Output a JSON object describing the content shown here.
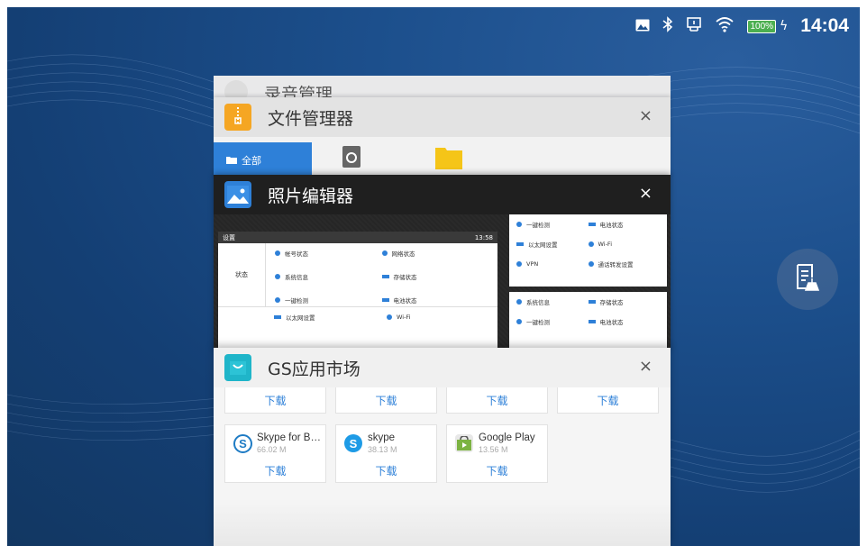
{
  "status_bar": {
    "battery": "100%",
    "time": "14:04"
  },
  "cards": {
    "recorder": {
      "title": "录音管理",
      "close": "×"
    },
    "file_manager": {
      "title": "文件管理器",
      "close": "×",
      "tab_all": "全部"
    },
    "photo_editor": {
      "title": "照片编辑器",
      "close": "×",
      "preview": {
        "settings_title": "设置",
        "status_time": "13:58",
        "section": "状态",
        "items": [
          "帐号状态",
          "网络状态",
          "系统信息",
          "存储状态",
          "一键检测",
          "电池状态",
          "以太网设置",
          "Wi-Fi"
        ],
        "right_items": [
          "一键检测",
          "电池状态",
          "以太网设置",
          "Wi-Fi",
          "VPN",
          "通话转发设置",
          "系统信息",
          "存储状态",
          "一键检测",
          "电池状态"
        ]
      }
    },
    "app_store": {
      "title": "GS应用市场",
      "close": "×",
      "download_label": "下载",
      "apps": [
        {
          "name": "Skype for Bus...",
          "size": "66.02 M",
          "icon": "skype-business-icon"
        },
        {
          "name": "skype",
          "size": "38.13 M",
          "icon": "skype-icon"
        },
        {
          "name": "Google Play",
          "size": "13.56 M",
          "icon": "google-play-icon"
        }
      ]
    }
  },
  "colors": {
    "accent": "#2e80d8",
    "wallpaper": "#1c4f8c",
    "battery": "#4caf50"
  }
}
